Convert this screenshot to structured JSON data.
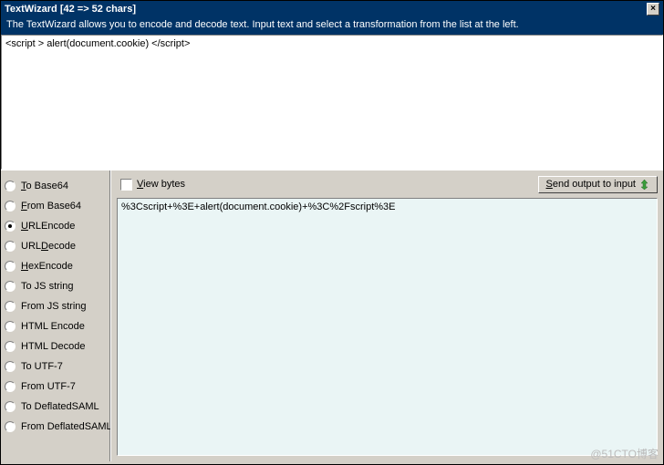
{
  "titlebar": {
    "title": "TextWizard [42 => 52 chars]"
  },
  "description": "The TextWizard allows you to encode and decode text. Input text and select a transformation from the list at the left.",
  "input": {
    "text": "<script > alert(document.cookie) </script>"
  },
  "sidebar": {
    "options": [
      {
        "id": "to-base64",
        "label": "To Base64",
        "access": "T",
        "selected": false
      },
      {
        "id": "from-base64",
        "label": "From Base64",
        "access": "F",
        "selected": false
      },
      {
        "id": "urlencode",
        "label": "URLEncode",
        "access": "U",
        "selected": true
      },
      {
        "id": "urldecode",
        "label": "URLDecode",
        "access": "D",
        "selected": false
      },
      {
        "id": "hexencode",
        "label": "HexEncode",
        "access": "H",
        "selected": false
      },
      {
        "id": "to-js-string",
        "label": "To JS string",
        "access": "",
        "selected": false
      },
      {
        "id": "from-js-string",
        "label": "From JS string",
        "access": "",
        "selected": false
      },
      {
        "id": "html-encode",
        "label": "HTML Encode",
        "access": "",
        "selected": false
      },
      {
        "id": "html-decode",
        "label": "HTML Decode",
        "access": "",
        "selected": false
      },
      {
        "id": "to-utf7",
        "label": "To UTF-7",
        "access": "",
        "selected": false
      },
      {
        "id": "from-utf7",
        "label": "From UTF-7",
        "access": "",
        "selected": false
      },
      {
        "id": "to-deflatedsaml",
        "label": "To DeflatedSAML",
        "access": "",
        "selected": false
      },
      {
        "id": "from-deflatedsaml",
        "label": "From DeflatedSAML",
        "access": "",
        "selected": false
      }
    ]
  },
  "output_toolbar": {
    "view_bytes_label": "View bytes",
    "send_button_label": "Send output to input"
  },
  "output": {
    "text": "%3Cscript+%3E+alert(document.cookie)+%3C%2Fscript%3E"
  },
  "watermark": "@51CTO博客"
}
